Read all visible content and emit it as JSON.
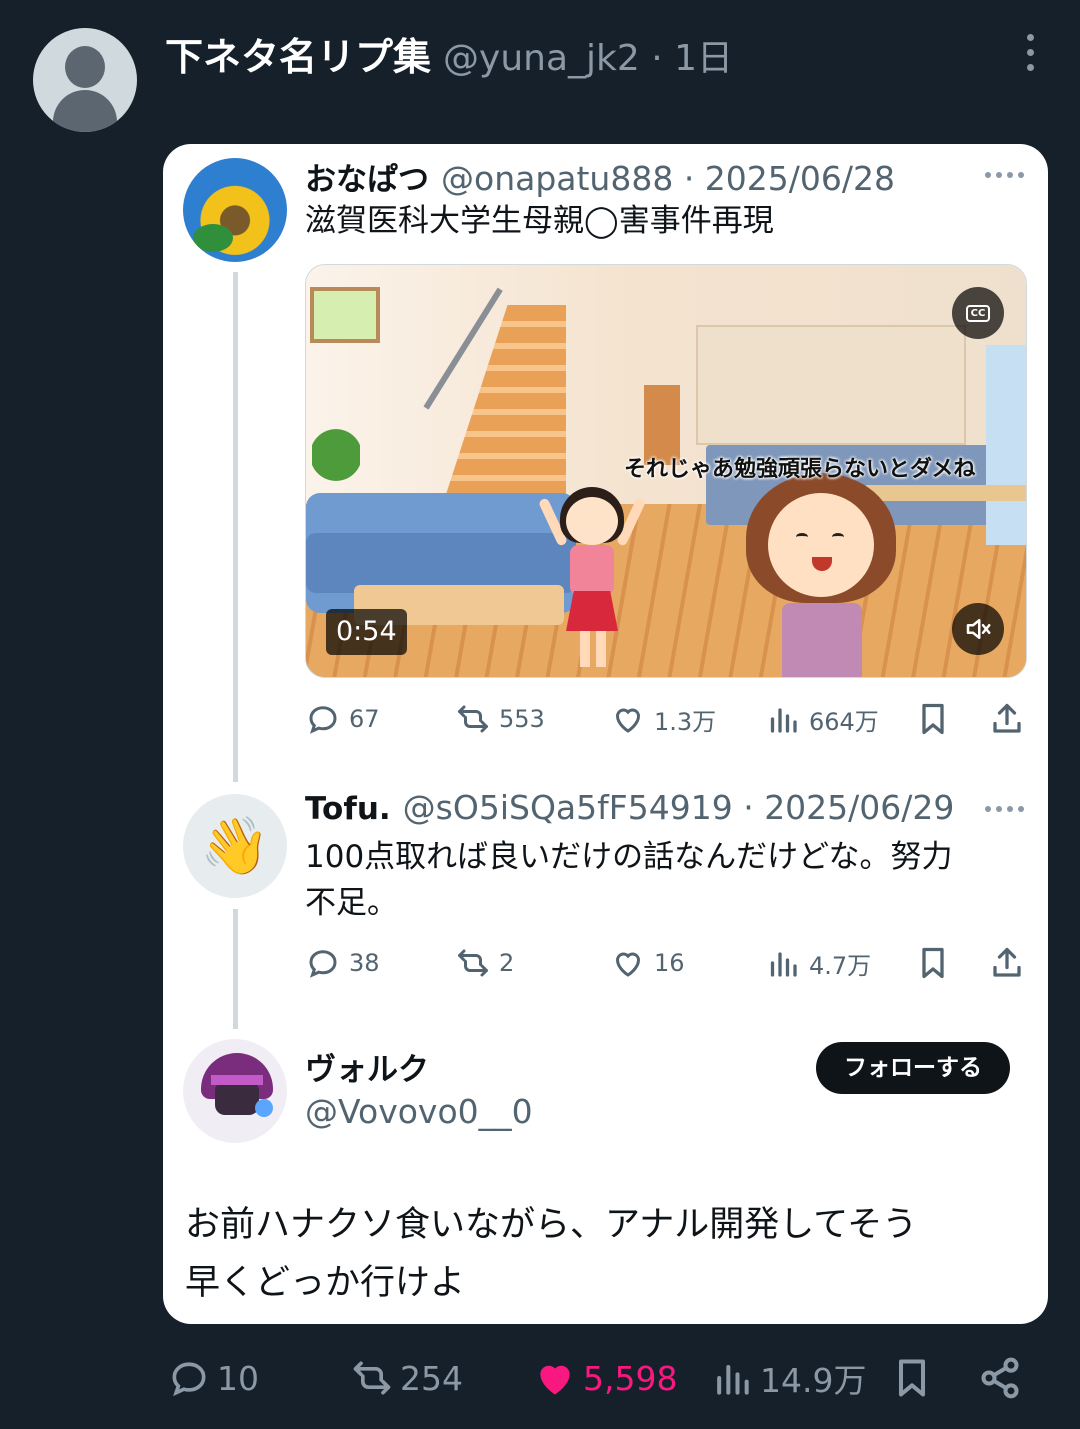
{
  "outer": {
    "author_name": "下ネタ名リプ集",
    "handle_time": "@yuna_jk2 · 1日",
    "actions": {
      "replies": "10",
      "retweets": "254",
      "likes": "5,598",
      "views": "14.9万"
    },
    "like_color": "#f91880"
  },
  "tweet1": {
    "name": "おなぱつ",
    "meta": "@onapatu888 · 2025/06/28",
    "text": "滋賀医科大学生母親◯害事件再現",
    "video": {
      "subtitle": "それじゃあ勉強頑張らないとダメね",
      "duration": "0:54",
      "cc_label": "CC"
    },
    "actions": {
      "replies": "67",
      "retweets": "553",
      "likes": "1.3万",
      "views": "664万"
    }
  },
  "tweet2": {
    "name": "Tofu.",
    "meta": "@sO5iSQa5fF54919 · 2025/06/29",
    "text_line1": "100点取れば良いだけの話なんだけどな。努力",
    "text_line2": "不足。",
    "avatar_emoji": "👋",
    "actions": {
      "replies": "38",
      "retweets": "2",
      "likes": "16",
      "views": "4.7万"
    }
  },
  "quote": {
    "name": "ヴォルク",
    "handle": "@Vovovo0__0",
    "follow_label": "フォローする",
    "text_line1": "お前ハナクソ食いながら、アナル開発してそう",
    "text_line2": "早くどっか行けよ"
  }
}
